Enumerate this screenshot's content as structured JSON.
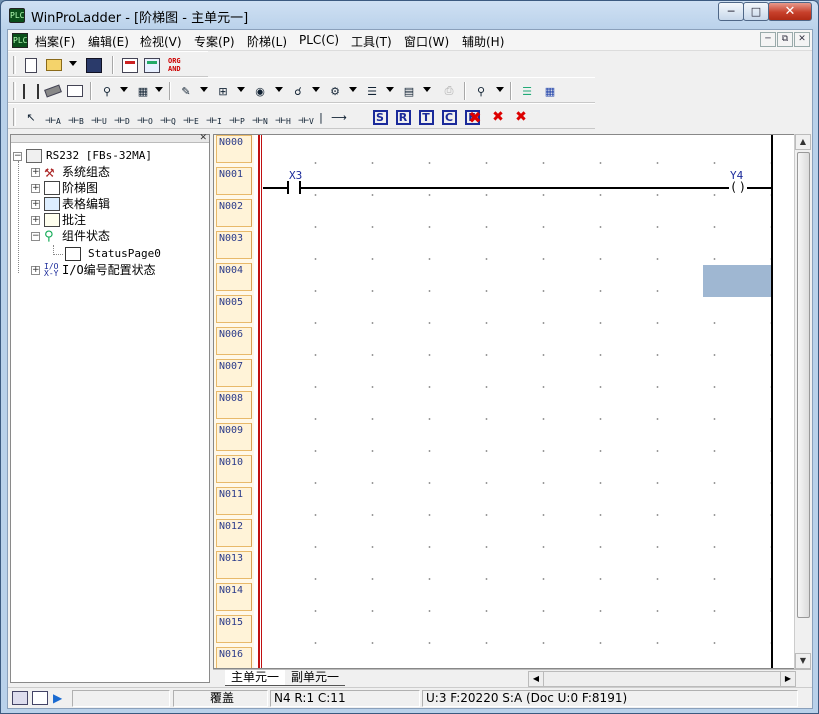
{
  "window": {
    "title": "WinProLadder - [阶梯图 - 主单元一]",
    "app_icon_text": "PLC"
  },
  "menubar": {
    "items": [
      {
        "label": "档案(F)"
      },
      {
        "label": "编辑(E)"
      },
      {
        "label": "检视(V)"
      },
      {
        "label": "专案(P)"
      },
      {
        "label": "阶梯(L)"
      },
      {
        "label": "PLC(C)"
      },
      {
        "label": "工具(T)"
      },
      {
        "label": "窗口(W)"
      },
      {
        "label": "辅助(H)"
      }
    ]
  },
  "toolbar1": {
    "org_and_label": "ORG AND"
  },
  "toolbar3": {
    "contact_letters": [
      "A",
      "B",
      "U",
      "D",
      "O",
      "Q",
      "E",
      "I",
      "P",
      "N",
      "H",
      "V"
    ],
    "func_letters": [
      "S",
      "R",
      "T",
      "C",
      "F"
    ]
  },
  "tree": {
    "root": "RS232 [FBs-32MA]",
    "items": [
      {
        "label": "系统组态"
      },
      {
        "label": "阶梯图"
      },
      {
        "label": "表格编辑"
      },
      {
        "label": "批注"
      },
      {
        "label": "组件状态"
      }
    ],
    "status_page": "StatusPage0",
    "io_config": "I/O编号配置状态"
  },
  "ladder": {
    "rung_labels": [
      "N000",
      "N001",
      "N002",
      "N003",
      "N004",
      "N005",
      "N006",
      "N007",
      "N008",
      "N009",
      "N010",
      "N011",
      "N012",
      "N013",
      "N014",
      "N015",
      "N016"
    ],
    "contact_label": "X3",
    "coil_label": "Y4"
  },
  "sheet_tabs": [
    "主单元一",
    "副单元一"
  ],
  "statusbar": {
    "mode": "覆盖",
    "position": "N4 R:1 C:11",
    "memory": "U:3 F:20220 S:A (Doc U:0 F:8191)"
  },
  "colors": {
    "power_rail": "#c01010",
    "rung_label_bg": "#fff3d8",
    "selection_cell": "#9fb7d2",
    "ladder_wire": "#000000",
    "label_text": "#1a2a9a"
  }
}
